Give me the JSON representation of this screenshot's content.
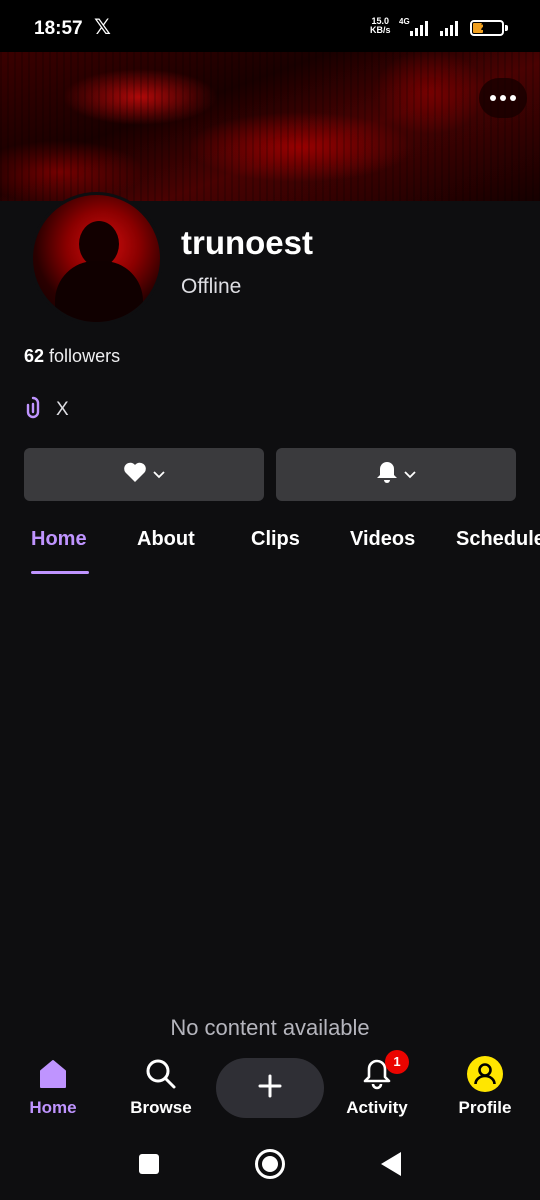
{
  "status_bar": {
    "time": "18:57",
    "notification_icon": "x-logo-icon",
    "network_speed_value": "15.0",
    "network_speed_unit": "KB/s",
    "network_type": "4G",
    "battery_level": "23"
  },
  "channel": {
    "username": "trunoest",
    "status": "Offline",
    "followers_count": "62",
    "followers_label": "followers",
    "social_link_label": "X"
  },
  "tabs": [
    {
      "label": "Home",
      "active": true
    },
    {
      "label": "About",
      "active": false
    },
    {
      "label": "Clips",
      "active": false
    },
    {
      "label": "Videos",
      "active": false
    },
    {
      "label": "Schedule",
      "active": false
    }
  ],
  "content": {
    "empty_message": "No content available"
  },
  "bottom_nav": {
    "home_label": "Home",
    "browse_label": "Browse",
    "activity_label": "Activity",
    "activity_badge": "1",
    "profile_label": "Profile"
  },
  "colors": {
    "accent": "#bf94ff",
    "background": "#0e0e10",
    "button": "#3a3a3d",
    "badge": "#eb0400",
    "profile_icon": "#ffe600"
  }
}
